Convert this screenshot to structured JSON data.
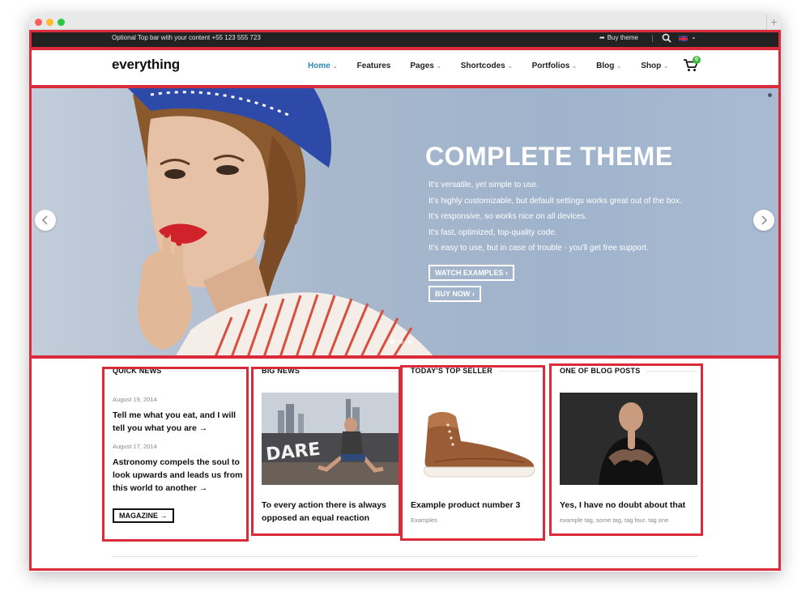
{
  "topbar": {
    "text": "Optional Top bar with your content +55 123 555 723",
    "buy_theme": "Buy theme"
  },
  "header": {
    "logo": "everything",
    "nav": [
      {
        "label": "Home",
        "active": true,
        "dropdown": true
      },
      {
        "label": "Features",
        "active": false,
        "dropdown": false
      },
      {
        "label": "Pages",
        "active": false,
        "dropdown": true
      },
      {
        "label": "Shortcodes",
        "active": false,
        "dropdown": true
      },
      {
        "label": "Portfolios",
        "active": false,
        "dropdown": true
      },
      {
        "label": "Blog",
        "active": false,
        "dropdown": true
      },
      {
        "label": "Shop",
        "active": false,
        "dropdown": true
      }
    ],
    "cart_count": "0"
  },
  "hero": {
    "title": "COMPLETE THEME",
    "lines": [
      "It's versatile, yet simple to use.",
      "It's highly customizable, but default settings works great out of the box.",
      "It's responsive, so works nice on all devices.",
      "It's fast, optimized, top-quality code.",
      "It's easy to use, but in case of trouble - you'll get free support."
    ],
    "button_watch": "WATCH EXAMPLES ›",
    "button_buy": "BUY NOW ›"
  },
  "columns": {
    "quick_news": {
      "title": "QUICK NEWS",
      "items": [
        {
          "date": "August 19, 2014",
          "title": "Tell me what you eat, and I will tell you what you are →"
        },
        {
          "date": "August 17, 2014",
          "title": "Astronomy compels the soul to look upwards and leads us from this world to another →"
        }
      ],
      "button": "MAGAZINE →"
    },
    "big_news": {
      "title": "BIG NEWS",
      "caption": "To every action there is always opposed an equal reaction"
    },
    "top_seller": {
      "title": "TODAY'S TOP SELLER",
      "caption": "Example product number 3",
      "sub": "Examples"
    },
    "blog_post": {
      "title": "ONE OF BLOG POSTS",
      "caption": "Yes, I have no doubt about that",
      "sub": "example tag, some tag, tag four, tag one"
    }
  },
  "colors": {
    "accent": "#2a8ab8",
    "highlight_box": "#d92b39",
    "topbar_bg": "#222222",
    "cart_badge": "#3cb83c"
  },
  "icons": [
    "search-icon",
    "arrow-icon",
    "flag-icon",
    "cart-icon",
    "chevron-left-icon",
    "chevron-right-icon"
  ]
}
